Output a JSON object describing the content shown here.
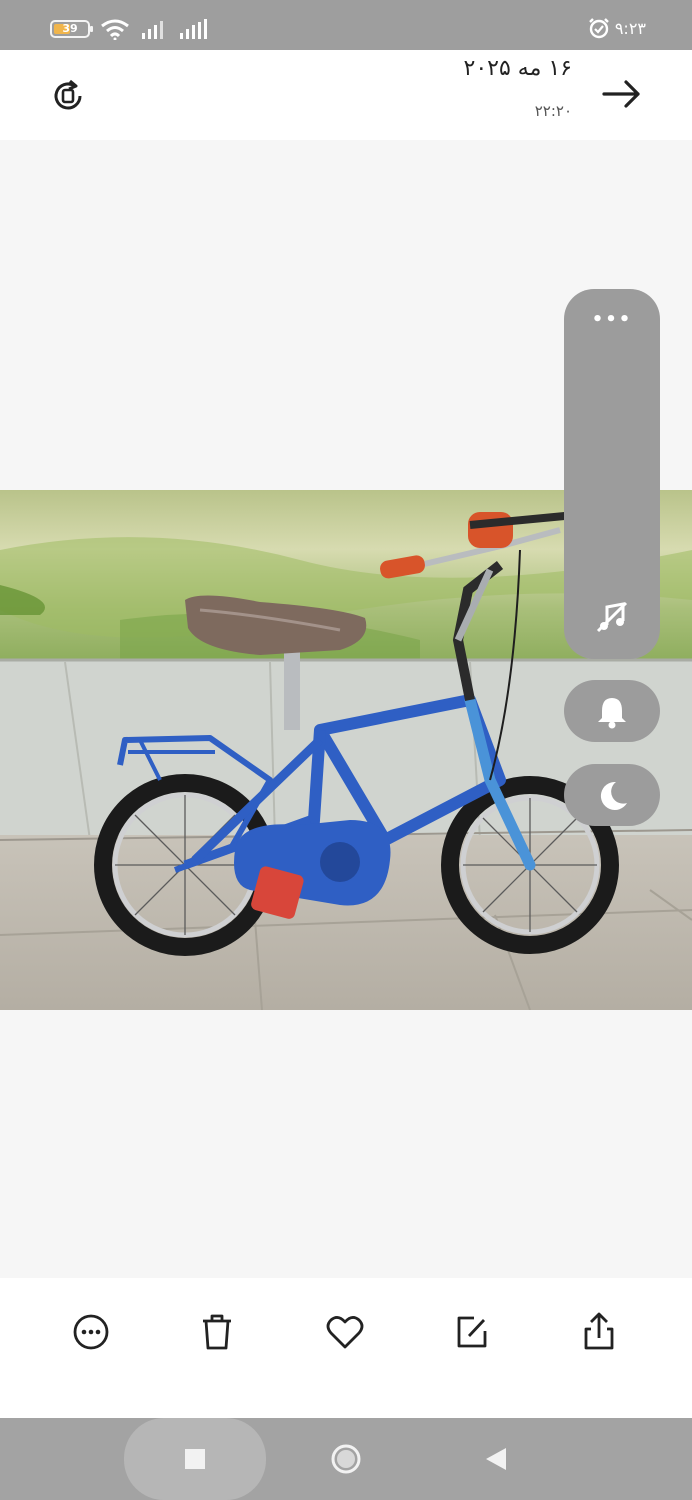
{
  "status_bar": {
    "battery_level": "39",
    "time": "۹:۲۳",
    "icons": [
      "battery-icon",
      "wifi-icon",
      "signal-icon",
      "signal-icon",
      "alarm-icon"
    ]
  },
  "header": {
    "date": "۱۶ مه ۲۰۲۵",
    "time": "۲۲:۲۰",
    "left_icon": "rotate-icon",
    "right_icon": "arrow-right-icon"
  },
  "photo": {
    "subject": "blue-kids-bicycle-icon",
    "colors": {
      "bike_blue": "#2f5fc4",
      "grips": "#d8542a",
      "wall": "#cfd3cc",
      "floor": "#bdb8ae"
    }
  },
  "side_panel": {
    "icons": [
      "more-dots-icon",
      "music-off-icon",
      "bell-icon",
      "moon-icon"
    ]
  },
  "toolbar": {
    "icons": [
      "more-circle-icon",
      "trash-icon",
      "heart-icon",
      "edit-icon",
      "share-icon"
    ]
  },
  "navbar": {
    "icons": [
      "recents-square-icon",
      "home-circle-icon",
      "back-triangle-icon"
    ]
  }
}
